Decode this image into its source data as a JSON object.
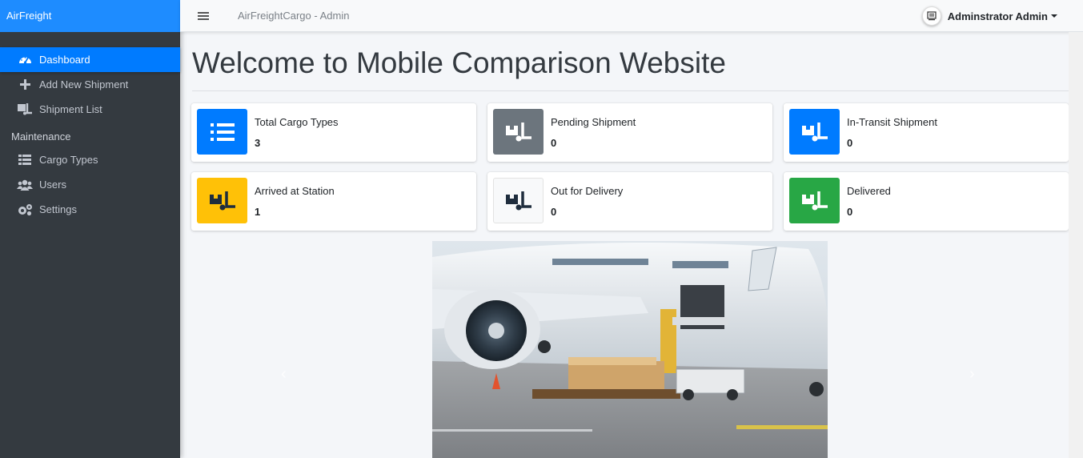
{
  "brand": "AirFreight",
  "topbar": {
    "title": "AirFreightCargo - Admin",
    "user_name": "Adminstrator Admin"
  },
  "sidebar": {
    "items": [
      {
        "label": "Dashboard",
        "icon": "tachometer-icon"
      },
      {
        "label": "Add New Shipment",
        "icon": "plus-icon"
      },
      {
        "label": "Shipment List",
        "icon": "dolly-icon"
      }
    ],
    "section_header": "Maintenance",
    "maintenance_items": [
      {
        "label": "Cargo Types",
        "icon": "th-list-icon"
      },
      {
        "label": "Users",
        "icon": "users-icon"
      },
      {
        "label": "Settings",
        "icon": "cogs-icon"
      }
    ]
  },
  "page_title": "Welcome to Mobile Comparison Website",
  "stats": [
    {
      "label": "Total Cargo Types",
      "value": "3",
      "color": "#007bff",
      "icon": "list-icon"
    },
    {
      "label": "Pending Shipment",
      "value": "0",
      "color": "#6c757d",
      "icon": "dolly-icon"
    },
    {
      "label": "In-Transit Shipment",
      "value": "0",
      "color": "#007bff",
      "icon": "dolly-icon"
    },
    {
      "label": "Arrived at Station",
      "value": "1",
      "color": "#ffc107",
      "icon": "dolly-icon"
    },
    {
      "label": "Out for Delivery",
      "value": "0",
      "color": "#f8f9fa",
      "icon": "dolly-icon"
    },
    {
      "label": "Delivered",
      "value": "0",
      "color": "#28a745",
      "icon": "dolly-icon"
    }
  ],
  "carousel": {
    "prev_glyph": "‹",
    "next_glyph": "›"
  }
}
